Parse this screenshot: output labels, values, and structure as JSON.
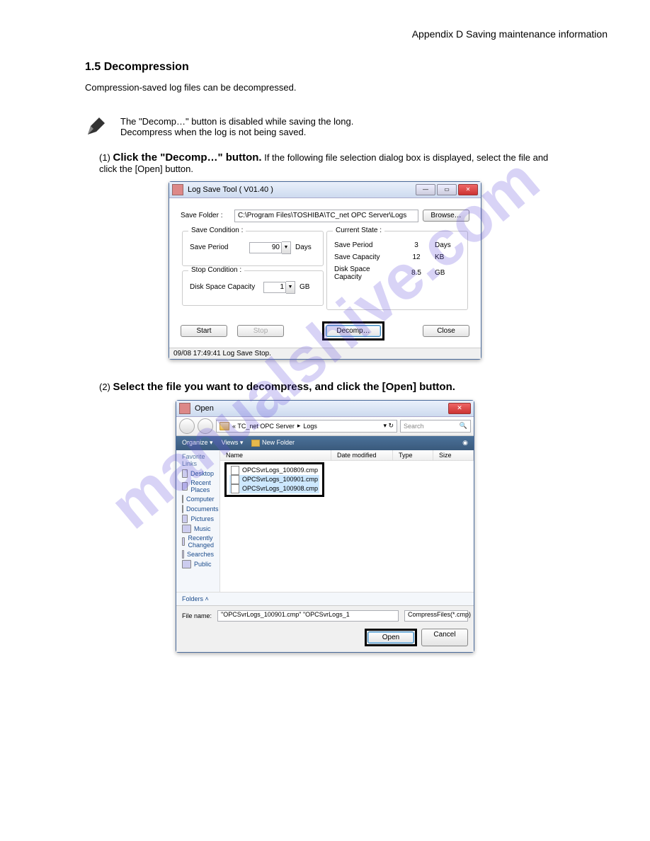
{
  "watermark": "manualshive.com",
  "header_right": "Appendix D  Saving maintenance information",
  "subsection_title": "1.5  Decompression",
  "intro_text": "Compression-saved log files can be decompressed.",
  "note_line1": "The \"Decomp…\" button is disabled while saving the long.",
  "note_line2": "Decompress when the log is not being saved.",
  "step1_label": "(1)",
  "step1_bold": "Click the \"Decomp…\" button.",
  "step1_after": " If the following file selection dialog box is displayed, select the file and click the [Open] button.",
  "step2_label": "(2)",
  "step2_bold": "Select the file you want to decompress, and click the [Open] button.",
  "win1": {
    "title": "Log Save Tool ( V01.40 )",
    "save_folder_lbl": "Save Folder :",
    "save_folder_val": "C:\\Program Files\\TOSHIBA\\TC_net OPC Server\\Logs",
    "browse_btn": "Browse…",
    "save_cond_lbl": "Save Condition :",
    "save_period_lbl": "Save Period",
    "save_period_val": "90",
    "days": "Days",
    "stop_cond_lbl": "Stop Condition :",
    "disk_space_lbl": "Disk Space Capacity",
    "disk_space_val": "1",
    "gb": "GB",
    "current_state_lbl": "Current State :",
    "cs_save_period_lbl": "Save Period",
    "cs_save_period_val": "3",
    "cs_save_cap_lbl": "Save Capacity",
    "cs_save_cap_val": "12",
    "kb": "KB",
    "cs_disk_lbl": "Disk Space Capacity",
    "cs_disk_val": "8.5",
    "start_btn": "Start",
    "stop_btn": "Stop",
    "decomp_btn": "Decomp…",
    "close_btn": "Close",
    "status": "09/08 17:49:41 Log Save Stop."
  },
  "win2": {
    "title": "Open",
    "breadcrumb1": "« TC_net OPC Server",
    "breadcrumb2": "Logs",
    "search_ph": "Search",
    "tb_organize": "Organize",
    "tb_views": "Views",
    "tb_newfolder": "New Folder",
    "fav_links": "Favorite Links",
    "side": [
      "Desktop",
      "Recent Places",
      "Computer",
      "Documents",
      "Pictures",
      "Music",
      "Recently Changed",
      "Searches",
      "Public"
    ],
    "col_name": "Name",
    "col_date": "Date modified",
    "col_type": "Type",
    "col_size": "Size",
    "files": [
      "OPCSvrLogs_100809.cmp",
      "OPCSvrLogs_100901.cmp",
      "OPCSvrLogs_100908.cmp"
    ],
    "folders": "Folders",
    "filename_lbl": "File name:",
    "filename_val": "\"OPCSvrLogs_100901.cmp\" \"OPCSvrLogs_1",
    "filter_val": "CompressFiles(*.cmp)",
    "open_btn": "Open",
    "cancel_btn": "Cancel"
  }
}
